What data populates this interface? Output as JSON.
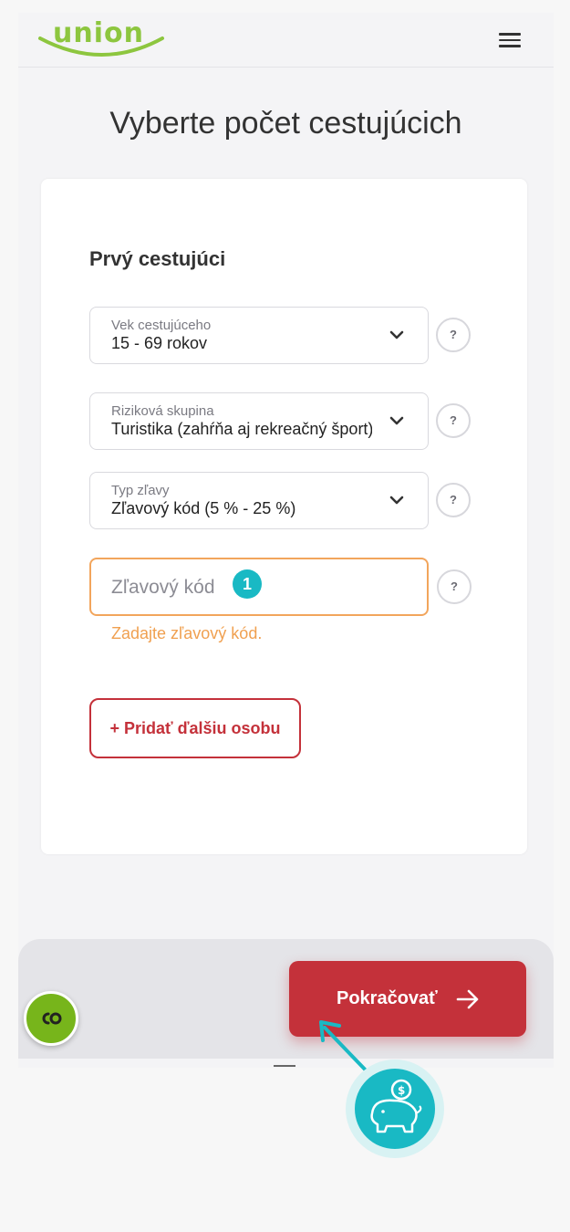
{
  "header": {
    "logo_text": "UNION",
    "brand_color": "#8dc63f",
    "menu_icon": "hamburger-icon"
  },
  "page": {
    "title": "Vyberte počet cestujúcich"
  },
  "form": {
    "section_title": "Prvý cestujúci",
    "age": {
      "label": "Vek cestujúceho",
      "value": "15 - 69 rokov"
    },
    "risk": {
      "label": "Riziková skupina",
      "value": "Turistika (zahŕňa aj rekreačný šport)"
    },
    "discount_type": {
      "label": "Typ zľavy",
      "value": "Zľavový kód (5 % - 25 %)"
    },
    "discount_code": {
      "placeholder": "Zľavový kód",
      "value": "",
      "step_number": "1"
    },
    "error": "Zadajte zľavový kód.",
    "help_label": "?",
    "add_person": "+ Pridať ďalšiu osobu"
  },
  "footer": {
    "continue_label": "Pokračovať",
    "accent_color": "#c4313a",
    "chat_icon": "chat-icon",
    "piggy_icon": "piggy-bank-icon"
  }
}
